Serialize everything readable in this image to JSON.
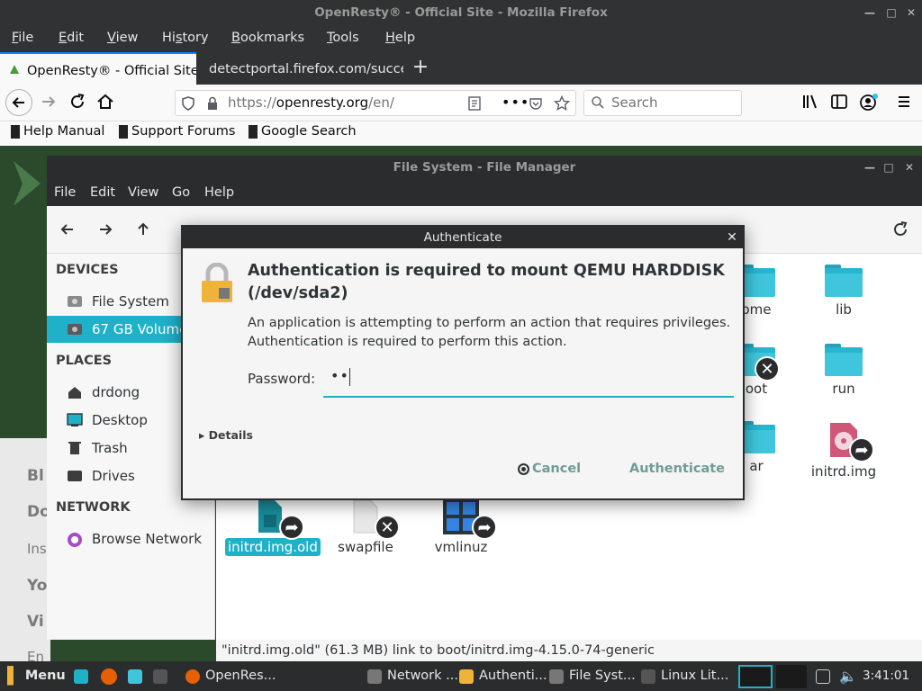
{
  "firefox": {
    "window_title": "OpenResty® - Official Site - Mozilla Firefox",
    "menu": {
      "file": {
        "u": "F",
        "rest": "ile"
      },
      "edit": {
        "u": "E",
        "rest": "dit"
      },
      "view": {
        "u": "V",
        "rest": "iew"
      },
      "history": {
        "pre": "Hi",
        "u": "s",
        "rest": "tory"
      },
      "bookmarks": {
        "u": "B",
        "rest": "ookmarks"
      },
      "tools": {
        "u": "T",
        "rest": "ools"
      },
      "help": {
        "u": "H",
        "rest": "elp"
      }
    },
    "tabs": [
      {
        "label": "OpenResty® - Official Site"
      },
      {
        "label": "detectportal.firefox.com/success.txt"
      }
    ],
    "url": {
      "prefix": "https://",
      "domain": "openresty.org",
      "path": "/en/"
    },
    "search_placeholder": "Search",
    "bookmarks": [
      "Help Manual",
      "Support Forums",
      "Google Search"
    ]
  },
  "web_background": {
    "snippets": [
      "Bl",
      "Do",
      "Ins",
      "Yo",
      "Vi",
      "En"
    ]
  },
  "file_manager": {
    "window_title": "File System - File Manager",
    "menu": [
      "File",
      "Edit",
      "View",
      "Go",
      "Help"
    ],
    "sidebar": {
      "devices_heading": "DEVICES",
      "devices": [
        {
          "label": "File System",
          "selected": false
        },
        {
          "label": "67 GB Volume",
          "selected": true
        }
      ],
      "places_heading": "PLACES",
      "places": [
        {
          "label": "drdong"
        },
        {
          "label": "Desktop"
        },
        {
          "label": "Trash"
        },
        {
          "label": "Drives"
        }
      ],
      "network_heading": "NETWORK",
      "network": [
        {
          "label": "Browse Network"
        }
      ]
    },
    "files": [
      {
        "label": "home",
        "visible": "ome"
      },
      {
        "label": "lib"
      },
      {
        "label": "boot",
        "visible": "oot"
      },
      {
        "label": "run"
      },
      {
        "label": "var",
        "visible": "ar"
      },
      {
        "label": "initrd.img"
      },
      {
        "label": "initrd.img.old",
        "selected": true
      },
      {
        "label": "swapfile"
      },
      {
        "label": "vmlinuz"
      }
    ],
    "status": "\"initrd.img.old\" (61.3 MB) link to boot/initrd.img-4.15.0-74-generic"
  },
  "auth_dialog": {
    "title": "Authenticate",
    "heading": "Authentication is required to mount QEMU HARDDISK (/dev/sda2)",
    "description_line1": "An application is attempting to perform an action that requires privileges.",
    "description_line2": "Authentication is required to perform this action.",
    "password_label": "Password:",
    "password_value": "••",
    "details_label": "Details",
    "cancel_label": "Cancel",
    "authenticate_label": "Authenticate"
  },
  "taskbar": {
    "menu_label": "Menu",
    "items": [
      {
        "label": "OpenRes..."
      },
      {
        "label": "Network ..."
      },
      {
        "label": "Authenti..."
      },
      {
        "label": "File Syst..."
      },
      {
        "label": "Linux Lit..."
      }
    ],
    "clock": "3:41:01 pm"
  },
  "colors": {
    "accent": "#1fb1c8",
    "dialog_button_text": "#6f9c95",
    "dark_chrome": "#2b2c2d",
    "firefox_focus_blue": "#0a84ff"
  }
}
